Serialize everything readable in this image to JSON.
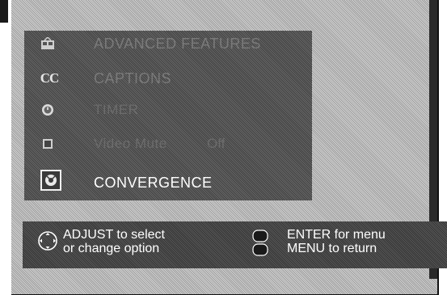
{
  "menu": {
    "items": [
      {
        "icon": "advanced-features-icon",
        "label": "ADVANCED FEATURES"
      },
      {
        "icon": "captions-icon",
        "label": "CAPTIONS",
        "icon_text": "CC"
      },
      {
        "icon": "timer-icon",
        "label": "TIMER"
      },
      {
        "icon": "video-mute-icon",
        "label": "Video Mute",
        "value": "Off"
      },
      {
        "icon": "convergence-icon",
        "label": "CONVERGENCE",
        "selected": true
      }
    ]
  },
  "help": {
    "adjust_line1": "ADJUST  to select",
    "adjust_line2": "or change option",
    "enter_line": "ENTER for menu",
    "menu_line": "MENU to return"
  },
  "colors": {
    "selected_text": "#ffffff",
    "dimmed_text": "#7a7a7a",
    "panel": "#5a5a5a",
    "screen": "#c9c9c9"
  }
}
